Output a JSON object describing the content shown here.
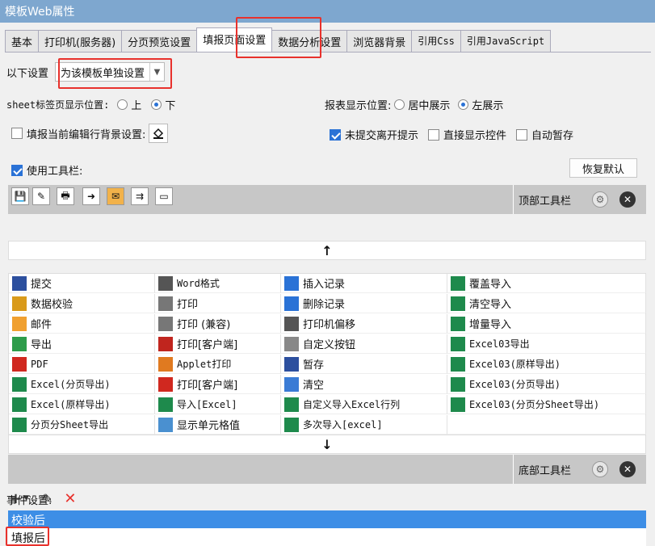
{
  "window": {
    "title": "模板Web属性"
  },
  "tabs": [
    {
      "label": "基本"
    },
    {
      "label": "打印机(服务器)"
    },
    {
      "label": "分页预览设置"
    },
    {
      "label": "填报页面设置"
    },
    {
      "label": "数据分析设置"
    },
    {
      "label": "浏览器背景"
    },
    {
      "label": "引用Css"
    },
    {
      "label": "引用JavaScript"
    }
  ],
  "settings": {
    "scope_label": "以下设置",
    "scope_value": "为该模板单独设置",
    "sheet_tab_label": "sheet标签页显示位置:",
    "sheet_top": "上",
    "sheet_bottom": "下",
    "report_pos_label": "报表显示位置:",
    "report_center": "居中展示",
    "report_left": "左展示",
    "edit_row_bg": "填报当前编辑行背景设置:",
    "unsubmitted_warn": "未提交离开提示",
    "show_controls": "直接显示控件",
    "auto_save": "自动暂存",
    "use_toolbar": "使用工具栏:",
    "restore_default": "恢复默认"
  },
  "top_toolbar": {
    "label": "顶部工具栏"
  },
  "bottom_toolbar": {
    "label": "底部工具栏"
  },
  "arrows": {
    "up": "↑",
    "down": "↓"
  },
  "buttons_grid": [
    {
      "label": "提交",
      "icon": "save-icon",
      "color": "#2c4f9e"
    },
    {
      "label": "Word格式",
      "icon": "word-icon",
      "color": "#555555"
    },
    {
      "label": "插入记录",
      "icon": "insert-record-icon",
      "color": "#2a72d6"
    },
    {
      "label": "覆盖导入",
      "icon": "excel-icon",
      "color": "#1e8a4c"
    },
    {
      "label": "数据校验",
      "icon": "pencil-icon",
      "color": "#d99a1a"
    },
    {
      "label": "打印",
      "icon": "printer-icon",
      "color": "#777777"
    },
    {
      "label": "删除记录",
      "icon": "delete-record-icon",
      "color": "#2a72d6"
    },
    {
      "label": "清空导入",
      "icon": "excel-icon",
      "color": "#1e8a4c"
    },
    {
      "label": "邮件",
      "icon": "mail-icon",
      "color": "#f0a030"
    },
    {
      "label": "打印 (兼容)",
      "icon": "printer-icon",
      "color": "#777777"
    },
    {
      "label": "打印机偏移",
      "icon": "move-icon",
      "color": "#555555"
    },
    {
      "label": "增量导入",
      "icon": "excel-icon",
      "color": "#1e8a4c"
    },
    {
      "label": "导出",
      "icon": "export-icon",
      "color": "#2d9c4a"
    },
    {
      "label": "打印[客户端]",
      "icon": "flash-print-icon",
      "color": "#c0251e"
    },
    {
      "label": "自定义按钮",
      "icon": "gear-icon",
      "color": "#888888"
    },
    {
      "label": "Excel03导出",
      "icon": "excel-icon",
      "color": "#1e8a4c"
    },
    {
      "label": "PDF",
      "icon": "pdf-icon",
      "color": "#d0281f"
    },
    {
      "label": "Applet打印",
      "icon": "applet-icon",
      "color": "#e07a20"
    },
    {
      "label": "暂存",
      "icon": "save-clock-icon",
      "color": "#2c4f9e"
    },
    {
      "label": "Excel03(原样导出)",
      "icon": "excel-icon",
      "color": "#1e8a4c"
    },
    {
      "label": "Excel(分页导出)",
      "icon": "excel-icon",
      "color": "#1e8a4c"
    },
    {
      "label": "打印[客户端]",
      "icon": "pdf-print-icon",
      "color": "#d0281f"
    },
    {
      "label": "清空",
      "icon": "eraser-icon",
      "color": "#3a7bd5"
    },
    {
      "label": "Excel03(分页导出)",
      "icon": "excel-icon",
      "color": "#1e8a4c"
    },
    {
      "label": "Excel(原样导出)",
      "icon": "excel-icon",
      "color": "#1e8a4c"
    },
    {
      "label": "导入[Excel]",
      "icon": "excel-icon",
      "color": "#1e8a4c"
    },
    {
      "label": "自定义导入Excel行列",
      "icon": "excel-icon",
      "color": "#1e8a4c"
    },
    {
      "label": "Excel03(分页分Sheet导出)",
      "icon": "excel-icon",
      "color": "#1e8a4c"
    },
    {
      "label": "分页分Sheet导出",
      "icon": "excel-icon",
      "color": "#1e8a4c"
    },
    {
      "label": "显示单元格值",
      "icon": "cell-icon",
      "color": "#4a90d0"
    },
    {
      "label": "多次导入[excel]",
      "icon": "excel-icon",
      "color": "#1e8a4c"
    },
    {
      "label": "",
      "icon": "",
      "color": "#ffffff"
    }
  ],
  "events": {
    "title": "事件设置:",
    "items": [
      {
        "label": "校验后"
      },
      {
        "label": "填报后"
      }
    ]
  },
  "colors": {
    "highlight": "#e8312c",
    "selection": "#3d8ee6",
    "accent": "#2a72d6"
  }
}
